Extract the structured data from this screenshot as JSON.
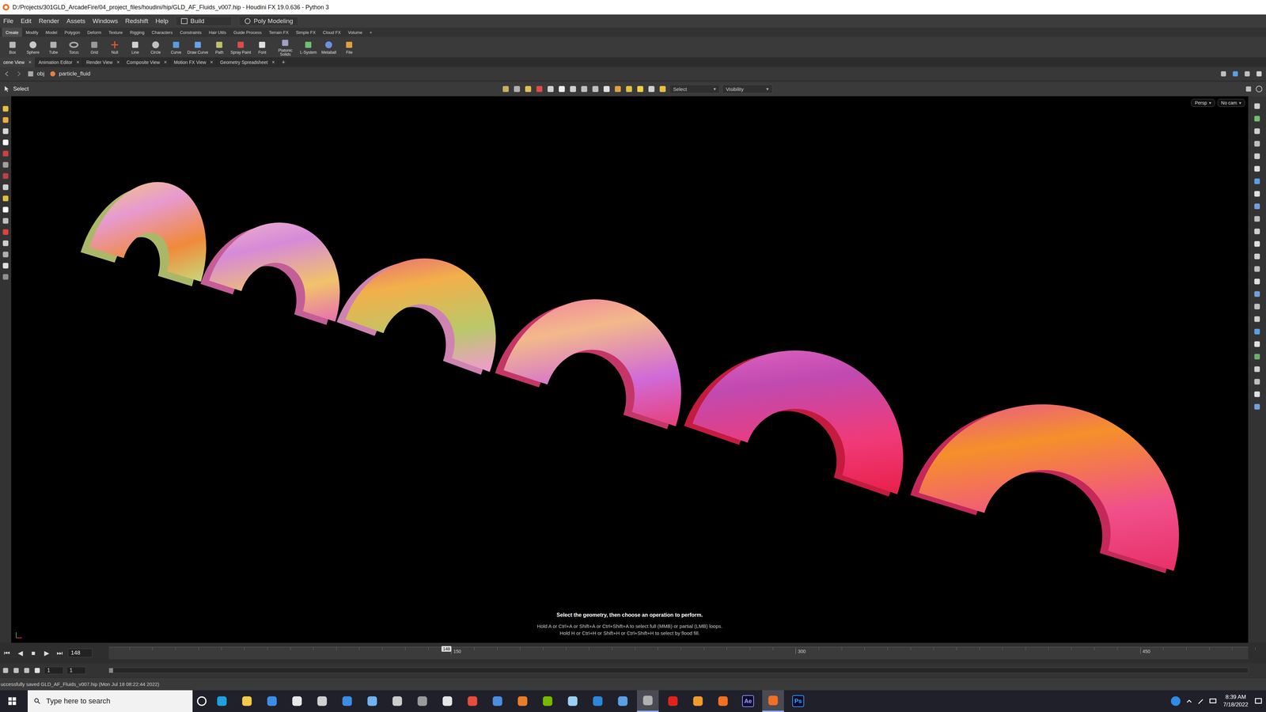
{
  "window": {
    "title": "D:/Projects/301GLD_ArcadeFire/04_project_files/houdini/hip/GLD_AF_Fluids_v007.hip - Houdini FX 19.0.636 - Python 3"
  },
  "menu": [
    "File",
    "Edit",
    "Render",
    "Assets",
    "Windows",
    "Redshift",
    "Help"
  ],
  "desktop": "Build",
  "workspace": "Poly Modeling",
  "caret": "▾",
  "plus": "+",
  "close": "×",
  "shelf_tabs": [
    {
      "label": "Create",
      "selected": true
    },
    {
      "label": "Modify",
      "selected": false
    },
    {
      "label": "Model",
      "selected": false
    },
    {
      "label": "Polygon",
      "selected": false
    },
    {
      "label": "Deform",
      "selected": false
    },
    {
      "label": "Texture",
      "selected": false
    },
    {
      "label": "Rigging",
      "selected": false
    },
    {
      "label": "Characters",
      "selected": false
    },
    {
      "label": "Constraints",
      "selected": false
    },
    {
      "label": "Hair Utils",
      "selected": false
    },
    {
      "label": "Guide Process",
      "selected": false
    },
    {
      "label": "Terrain FX",
      "selected": false
    },
    {
      "label": "Simple FX",
      "selected": false
    },
    {
      "label": "Cloud FX",
      "selected": false
    },
    {
      "label": "Volume",
      "selected": false
    }
  ],
  "shelf_tools": [
    "Box",
    "Sphere",
    "Tube",
    "Torus",
    "Grid",
    "Null",
    "Line",
    "Circle",
    "Curve",
    "Draw Curve",
    "Path",
    "Spray Paint",
    "Font",
    "Platonic Solids",
    "L-System",
    "Metaball",
    "File"
  ],
  "pane_tabs": [
    {
      "label": "cene View",
      "selected": true
    },
    {
      "label": "Animation Editor",
      "selected": false
    },
    {
      "label": "Render View",
      "selected": false
    },
    {
      "label": "Composite View",
      "selected": false
    },
    {
      "label": "Motion FX View",
      "selected": false
    },
    {
      "label": "Geometry Spreadsheet",
      "selected": false
    }
  ],
  "path": [
    "obj",
    "particle_fluid"
  ],
  "viewport_toolbar": {
    "mode": "Select",
    "selection": "Select",
    "visibility": "Visibility"
  },
  "viewport": {
    "projection": "Persp",
    "camera": "No cam",
    "hint_title": "Select the geometry, then choose an operation to perform.",
    "hint_lines": [
      "Hold A or Ctrl+A or Shift+A or Ctrl+Shift+A to select full (MMB) or partial (LMB) loops.",
      "Hold H or Ctrl+H or Shift+H or Ctrl+Shift+H to select by flood fill."
    ]
  },
  "timeline": {
    "controls": [
      "⏮",
      "◀",
      "■",
      "▶",
      "⏭"
    ],
    "frame": "148",
    "ticks": [
      "150",
      "300",
      "450"
    ]
  },
  "range": {
    "start": "1",
    "end": "1"
  },
  "status": "uccessfully saved GLD_AF_Fluids_v007.hip (Mon Jul 18 08:22:44 2022)",
  "taskbar": {
    "search": "Type here to search",
    "time": "8:39 AM",
    "date": "7/18/2022",
    "apps": [
      {
        "color": "#1fa0e0",
        "selected": false
      },
      {
        "color": "#f2c94c",
        "selected": false
      },
      {
        "color": "#3a8ee6",
        "selected": false
      },
      {
        "color": "#e8e8e8",
        "selected": false
      },
      {
        "color": "#d0d0d0",
        "selected": false
      },
      {
        "color": "#3a8ee6",
        "selected": false
      },
      {
        "color": "#6fb3f2",
        "selected": false
      },
      {
        "color": "#cccccc",
        "selected": false
      },
      {
        "color": "#9a9a9a",
        "selected": false
      },
      {
        "color": "#e6e6e6",
        "selected": false
      },
      {
        "color": "#e94b3c",
        "selected": false
      },
      {
        "color": "#4a8fe0",
        "selected": false
      },
      {
        "color": "#e87d2a",
        "selected": false
      },
      {
        "color": "#76b900",
        "selected": false
      },
      {
        "color": "#9bd1f2",
        "selected": false
      },
      {
        "color": "#2b88d8",
        "selected": false
      },
      {
        "color": "#5aa0e6",
        "selected": false
      },
      {
        "color": "#b0b0b0",
        "selected": true
      },
      {
        "color": "#e2231a",
        "selected": false
      },
      {
        "color": "#f09b2e",
        "selected": false
      },
      {
        "color": "#f36f21",
        "selected": false
      },
      {
        "color": "#9999ff",
        "label": "Ae",
        "selected": false
      },
      {
        "color": "#f36f21",
        "selected": true
      },
      {
        "color": "#31a8ff",
        "label": "Ps",
        "selected": false
      }
    ]
  }
}
